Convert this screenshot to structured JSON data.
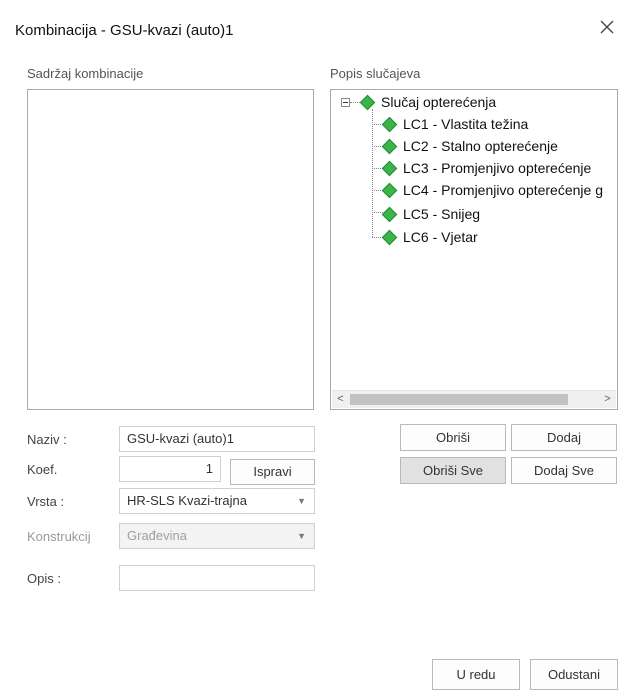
{
  "window": {
    "title": "Kombinacija - GSU-kvazi (auto)1",
    "close_icon": "close-icon"
  },
  "left_panel": {
    "label": "Sadržaj kombinacije"
  },
  "right_panel": {
    "label": "Popis slučajeva",
    "tree": {
      "root": "Slučaj opterećenja",
      "children": [
        "LC1 - Vlastita težina",
        "LC2 - Stalno opterećenje",
        "LC3 - Promjenjivo opterećenje",
        "LC4 - Promjenjivo opterećenje g",
        "LC5 - Snijeg",
        "LC6 - Vjetar"
      ]
    },
    "scroll_left": "<",
    "scroll_right": ">"
  },
  "buttons": {
    "obrisi": "Obriši",
    "dodaj": "Dodaj",
    "obrisi_sve": "Obriši Sve",
    "dodaj_sve": "Dodaj Sve",
    "ispravi": "Ispravi",
    "u_redu": "U redu",
    "odustani": "Odustani"
  },
  "form": {
    "naziv_label": "Naziv :",
    "naziv_value": "GSU-kvazi (auto)1",
    "koef_label": "Koef.",
    "koef_value": "1",
    "vrsta_label": "Vrsta :",
    "vrsta_value": "HR-SLS Kvazi-trajna",
    "konstrukcija_label": "Konstrukcij",
    "konstrukcija_value": "Građevina",
    "opis_label": "Opis :",
    "opis_value": ""
  },
  "colors": {
    "node_icon": "#3bb54a",
    "pressed_button": "#e1e1e1"
  }
}
